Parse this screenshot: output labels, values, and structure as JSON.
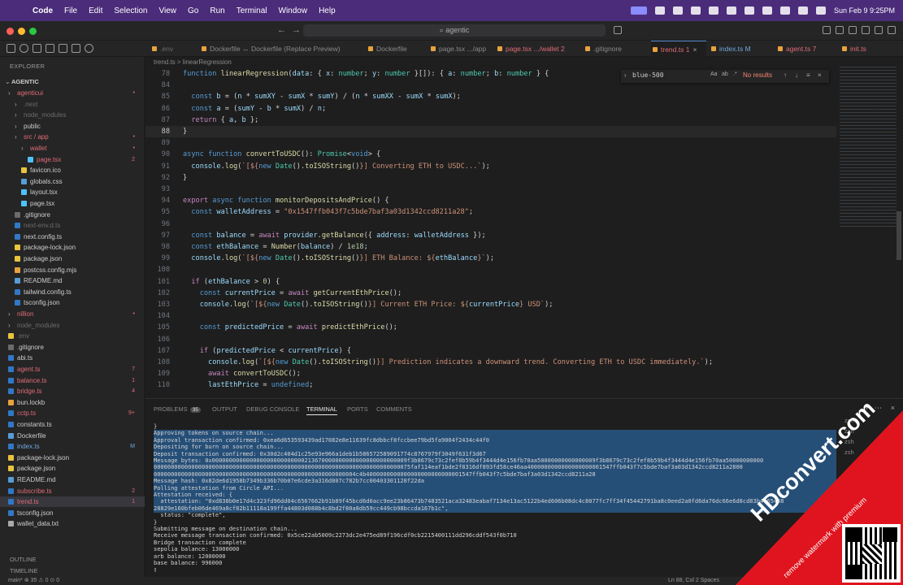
{
  "menubar": {
    "app": "Code",
    "items": [
      "File",
      "Edit",
      "Selection",
      "View",
      "Go",
      "Run",
      "Terminal",
      "Window",
      "Help"
    ],
    "clock": "Sun Feb 9  9:25PM"
  },
  "titlebar": {
    "search": "agentic"
  },
  "explorer": {
    "header": "EXPLORER",
    "root": "AGENTIC",
    "items": [
      {
        "label": "agenticui",
        "depth": 0,
        "color": "#e06c75",
        "badge": "•",
        "type": "folder"
      },
      {
        "label": ".next",
        "depth": 1,
        "color": "#6b6b6b",
        "type": "folder"
      },
      {
        "label": "node_modules",
        "depth": 1,
        "color": "#6b6b6b",
        "type": "folder"
      },
      {
        "label": "public",
        "depth": 1,
        "color": "#cccccc",
        "type": "folder"
      },
      {
        "label": "src / app",
        "depth": 1,
        "color": "#e06c75",
        "badge": "•",
        "type": "folder"
      },
      {
        "label": "wallet",
        "depth": 2,
        "color": "#e06c75",
        "badge": "•",
        "type": "folder"
      },
      {
        "label": "page.tsx",
        "depth": 3,
        "color": "#e06c75",
        "badge": "2",
        "type": "file",
        "icon": "#4fc1ff"
      },
      {
        "label": "favicon.ico",
        "depth": 2,
        "color": "#cccccc",
        "type": "file",
        "icon": "#e8c33d"
      },
      {
        "label": "globals.css",
        "depth": 2,
        "color": "#cccccc",
        "type": "file",
        "icon": "#569cd6"
      },
      {
        "label": "layout.tsx",
        "depth": 2,
        "color": "#cccccc",
        "type": "file",
        "icon": "#4fc1ff"
      },
      {
        "label": "page.tsx",
        "depth": 2,
        "color": "#cccccc",
        "type": "file",
        "icon": "#4fc1ff"
      },
      {
        "label": ".gitignore",
        "depth": 1,
        "color": "#cccccc",
        "type": "file",
        "icon": "#6b6b6b"
      },
      {
        "label": "next-env.d.ts",
        "depth": 1,
        "color": "#6b6b6b",
        "type": "file",
        "icon": "#3178c6"
      },
      {
        "label": "next.config.ts",
        "depth": 1,
        "color": "#cccccc",
        "type": "file",
        "icon": "#3178c6"
      },
      {
        "label": "package-lock.json",
        "depth": 1,
        "color": "#cccccc",
        "type": "file",
        "icon": "#e8c33d"
      },
      {
        "label": "package.json",
        "depth": 1,
        "color": "#cccccc",
        "type": "file",
        "icon": "#e8c33d"
      },
      {
        "label": "postcss.config.mjs",
        "depth": 1,
        "color": "#cccccc",
        "type": "file",
        "icon": "#e8a33d"
      },
      {
        "label": "README.md",
        "depth": 1,
        "color": "#cccccc",
        "type": "file",
        "icon": "#569cd6"
      },
      {
        "label": "tailwind.config.ts",
        "depth": 1,
        "color": "#cccccc",
        "type": "file",
        "icon": "#3178c6"
      },
      {
        "label": "tsconfig.json",
        "depth": 1,
        "color": "#cccccc",
        "type": "file",
        "icon": "#3178c6"
      },
      {
        "label": "nillion",
        "depth": 0,
        "color": "#e06c75",
        "badge": "•",
        "type": "folder"
      },
      {
        "label": "node_modules",
        "depth": 0,
        "color": "#6b6b6b",
        "type": "folder"
      },
      {
        "label": ".env",
        "depth": 0,
        "color": "#6b6b6b",
        "type": "file",
        "icon": "#e8c33d"
      },
      {
        "label": ".gitignore",
        "depth": 0,
        "color": "#cccccc",
        "type": "file",
        "icon": "#6b6b6b"
      },
      {
        "label": "abi.ts",
        "depth": 0,
        "color": "#cccccc",
        "type": "file",
        "icon": "#3178c6"
      },
      {
        "label": "agent.ts",
        "depth": 0,
        "color": "#e06c75",
        "badge": "7",
        "type": "file",
        "icon": "#3178c6"
      },
      {
        "label": "balance.ts",
        "depth": 0,
        "color": "#e06c75",
        "badge": "1",
        "type": "file",
        "icon": "#3178c6"
      },
      {
        "label": "bridge.ts",
        "depth": 0,
        "color": "#e06c75",
        "badge": "4",
        "type": "file",
        "icon": "#3178c6"
      },
      {
        "label": "bun.lockb",
        "depth": 0,
        "color": "#cccccc",
        "type": "file",
        "icon": "#e8a33d"
      },
      {
        "label": "cctp.ts",
        "depth": 0,
        "color": "#e06c75",
        "badge": "9+",
        "type": "file",
        "icon": "#3178c6"
      },
      {
        "label": "constants.ts",
        "depth": 0,
        "color": "#cccccc",
        "type": "file",
        "icon": "#3178c6"
      },
      {
        "label": "Dockerfile",
        "depth": 0,
        "color": "#cccccc",
        "type": "file",
        "icon": "#569cd6"
      },
      {
        "label": "index.ts",
        "depth": 0,
        "color": "#6fa8dc",
        "badge": "M",
        "type": "file",
        "icon": "#3178c6"
      },
      {
        "label": "package-lock.json",
        "depth": 0,
        "color": "#cccccc",
        "type": "file",
        "icon": "#e8c33d"
      },
      {
        "label": "package.json",
        "depth": 0,
        "color": "#cccccc",
        "type": "file",
        "icon": "#e8c33d"
      },
      {
        "label": "README.md",
        "depth": 0,
        "color": "#cccccc",
        "type": "file",
        "icon": "#569cd6"
      },
      {
        "label": "subscribe.ts",
        "depth": 0,
        "color": "#e06c75",
        "badge": "2",
        "type": "file",
        "icon": "#3178c6"
      },
      {
        "label": "trend.ts",
        "depth": 0,
        "color": "#e06c75",
        "badge": "1",
        "type": "file",
        "icon": "#3178c6",
        "selected": true
      },
      {
        "label": "tsconfig.json",
        "depth": 0,
        "color": "#cccccc",
        "type": "file",
        "icon": "#3178c6"
      },
      {
        "label": "wallet_data.txt",
        "depth": 0,
        "color": "#cccccc",
        "type": "file",
        "icon": "#aaaaaa"
      }
    ],
    "outline": "OUTLINE",
    "timeline": "TIMELINE"
  },
  "tabs": [
    {
      "label": ".env",
      "x": 0,
      "color": "#6b6b6b"
    },
    {
      "label": "Dockerfile ↔ Dockerfile (Replace Preview)",
      "color": "#8a8a8a"
    },
    {
      "label": "Dockerfile",
      "color": "#8a8a8a"
    },
    {
      "label": "page.tsx  .../app",
      "color": "#8a8a8a"
    },
    {
      "label": "page.tsx  .../wallet  2",
      "color": "#e06c75"
    },
    {
      "label": ".gitignore",
      "color": "#8a8a8a"
    },
    {
      "label": "trend.ts  1",
      "color": "#e06c75",
      "active": true
    },
    {
      "label": "index.ts  M",
      "color": "#6fa8dc"
    },
    {
      "label": "agent.ts  7",
      "color": "#e06c75"
    },
    {
      "label": "init.ts",
      "color": "#e06c75"
    }
  ],
  "breadcrumb": "trend.ts  >  linearRegression",
  "find": {
    "query": "blue-500",
    "result": "No results"
  },
  "code": [
    {
      "ln": "78",
      "html": "<span class='kb'>function</span> <span class='f'>linearRegression</span><span class='p'>(</span><span class='v'>data</span><span class='p'>: { </span><span class='v'>x</span><span class='p'>: </span><span class='t'>number</span><span class='p'>; </span><span class='v'>y</span><span class='p'>: </span><span class='t'>number</span><span class='p'> }[]): { </span><span class='v'>a</span><span class='p'>: </span><span class='t'>number</span><span class='p'>; </span><span class='v'>b</span><span class='p'>: </span><span class='t'>number</span><span class='p'> } {</span>"
    },
    {
      "ln": "84",
      "html": ""
    },
    {
      "ln": "85",
      "html": "  <span class='kb'>const</span> <span class='v'>b</span> <span class='p'>= (</span><span class='v'>n</span> <span class='p'>*</span> <span class='v'>sumXY</span> <span class='p'>-</span> <span class='v'>sumX</span> <span class='p'>*</span> <span class='v'>sumY</span><span class='p'>) / (</span><span class='v'>n</span> <span class='p'>*</span> <span class='v'>sumXX</span> <span class='p'>-</span> <span class='v'>sumX</span> <span class='p'>*</span> <span class='v'>sumX</span><span class='p'>);</span>"
    },
    {
      "ln": "86",
      "html": "  <span class='kb'>const</span> <span class='v'>a</span> <span class='p'>= (</span><span class='v'>sumY</span> <span class='p'>-</span> <span class='v'>b</span> <span class='p'>*</span> <span class='v'>sumX</span><span class='p'>) /</span> <span class='v'>n</span><span class='p'>;</span>"
    },
    {
      "ln": "87",
      "html": "  <span class='k'>return</span> <span class='p'>{ </span><span class='v'>a</span><span class='p'>, </span><span class='v'>b</span><span class='p'> };</span>"
    },
    {
      "ln": "88",
      "html": "<span class='p'>}</span>",
      "cur": true
    },
    {
      "ln": "89",
      "html": ""
    },
    {
      "ln": "90",
      "html": "<span class='kb'>async</span> <span class='kb'>function</span> <span class='f'>convertToUSDC</span><span class='p'>(): </span><span class='t'>Promise</span><span class='p'>&lt;</span><span class='kb'>void</span><span class='p'>&gt; {</span>"
    },
    {
      "ln": "91",
      "html": "  <span class='v'>console</span><span class='p'>.</span><span class='f'>log</span><span class='p'>(</span><span class='tpl'>`[${</span><span class='kb'>new</span> <span class='t'>Date</span><span class='p'>().</span><span class='f'>toISOString</span><span class='p'>()</span><span class='tpl'>}] Converting ETH to USDC...`</span><span class='p'>);</span>"
    },
    {
      "ln": "92",
      "html": "<span class='p'>}</span>"
    },
    {
      "ln": "93",
      "html": ""
    },
    {
      "ln": "94",
      "html": "<span class='k'>export</span> <span class='kb'>async</span> <span class='kb'>function</span> <span class='f'>monitorDepositsAndPrice</span><span class='p'>() {</span>"
    },
    {
      "ln": "95",
      "html": "  <span class='kb'>const</span> <span class='v'>walletAddress</span> <span class='p'>=</span> <span class='s'>\"0x1547ffb043f7c5bde7baf3a03d1342ccd8211a28\"</span><span class='p'>;</span>"
    },
    {
      "ln": "96",
      "html": ""
    },
    {
      "ln": "97",
      "html": "  <span class='kb'>const</span> <span class='v'>balance</span> <span class='p'>=</span> <span class='k'>await</span> <span class='v'>provider</span><span class='p'>.</span><span class='f'>getBalance</span><span class='p'>({ </span><span class='v'>address</span><span class='p'>: </span><span class='v'>walletAddress</span><span class='p'> });</span>"
    },
    {
      "ln": "98",
      "html": "  <span class='kb'>const</span> <span class='v'>ethBalance</span> <span class='p'>=</span> <span class='f'>Number</span><span class='p'>(</span><span class='v'>balance</span><span class='p'>) /</span> <span class='n'>1e18</span><span class='p'>;</span>"
    },
    {
      "ln": "99",
      "html": "  <span class='v'>console</span><span class='p'>.</span><span class='f'>log</span><span class='p'>(</span><span class='tpl'>`[${</span><span class='kb'>new</span> <span class='t'>Date</span><span class='p'>().</span><span class='f'>toISOString</span><span class='p'>()</span><span class='tpl'>}] ETH Balance: ${</span><span class='v'>ethBalance</span><span class='tpl'>}`</span><span class='p'>);</span>"
    },
    {
      "ln": "100",
      "html": ""
    },
    {
      "ln": "101",
      "html": "  <span class='k'>if</span> <span class='p'>(</span><span class='v'>ethBalance</span> <span class='p'>&gt;</span> <span class='n'>0</span><span class='p'>) {</span>"
    },
    {
      "ln": "102",
      "html": "    <span class='kb'>const</span> <span class='v'>currentPrice</span> <span class='p'>=</span> <span class='k'>await</span> <span class='f'>getCurrentEthPrice</span><span class='p'>();</span>"
    },
    {
      "ln": "103",
      "html": "    <span class='v'>console</span><span class='p'>.</span><span class='f'>log</span><span class='p'>(</span><span class='tpl'>`[${</span><span class='kb'>new</span> <span class='t'>Date</span><span class='p'>().</span><span class='f'>toISOString</span><span class='p'>()</span><span class='tpl'>}] Current ETH Price: ${</span><span class='v'>currentPrice</span><span class='tpl'>} USD`</span><span class='p'>);</span>"
    },
    {
      "ln": "104",
      "html": ""
    },
    {
      "ln": "105",
      "html": "    <span class='kb'>const</span> <span class='v'>predictedPrice</span> <span class='p'>=</span> <span class='k'>await</span> <span class='f'>predictEthPrice</span><span class='p'>();</span>"
    },
    {
      "ln": "106",
      "html": ""
    },
    {
      "ln": "107",
      "html": "    <span class='k'>if</span> <span class='p'>(</span><span class='v'>predictedPrice</span> <span class='p'>&lt;</span> <span class='v'>currentPrice</span><span class='p'>) {</span>"
    },
    {
      "ln": "108",
      "html": "      <span class='v'>console</span><span class='p'>.</span><span class='f'>log</span><span class='p'>(</span><span class='tpl'>`[${</span><span class='kb'>new</span> <span class='t'>Date</span><span class='p'>().</span><span class='f'>toISOString</span><span class='p'>()</span><span class='tpl'>}] Prediction indicates a downward trend. Converting ETH to USDC immediately.`</span><span class='p'>);</span>"
    },
    {
      "ln": "109",
      "html": "      <span class='k'>await</span> <span class='f'>convertToUSDC</span><span class='p'>();</span>"
    },
    {
      "ln": "110",
      "html": "      <span class='v'>lastEthPrice</span> <span class='p'>=</span> <span class='kb'>undefined</span><span class='p'>;</span>"
    }
  ],
  "panel": {
    "tabs": [
      {
        "label": "PROBLEMS",
        "count": "35"
      },
      {
        "label": "OUTPUT"
      },
      {
        "label": "DEBUG CONSOLE"
      },
      {
        "label": "TERMINAL",
        "active": true
      },
      {
        "label": "PORTS"
      },
      {
        "label": "COMMENTS"
      }
    ],
    "terminals": [
      "zsh",
      "zsh",
      "zsh",
      "zsh"
    ],
    "lines": [
      {
        "t": "}"
      },
      {
        "t": "Approving tokens on source chain...",
        "hl": true
      },
      {
        "t": "Approval transaction confirmed: 0xea6d653593439ad17082e8e11639fc8dbbcf8fccbee79bd5fa9004f2434c44f0",
        "hl": true
      },
      {
        "t": "Depositing for burn on source chain...",
        "hl": true
      },
      {
        "t": "Deposit transaction confirmed: 0x30d2c404d1c25e93e966a1deb1b586572589091774c8767979f3049f631f3d67",
        "hl": true
      },
      {
        "t": "Message bytes: 0x000000000000000000000000000213670000000000000000000000009f3b8679c73c2fef8b59b4f3444d4e156fb70aa50000000000000009f3b8679c73c2fef8b59b4f3444d4e156fb70aa50000000000",
        "hl": true
      },
      {
        "t": "000000000000000000000000000000000000000000000000000000000000000000000000075faf114eaf1bde2f8316df893fd58ce46aa4000000000000000000001547ffb043f7c5bde7baf3a03d1342ccd8211a2800",
        "hl": true
      },
      {
        "t": "00000000000000000000000000000000000000000000000000000000004c4b4000000000000000000000000001547ffb043f7c5bde7baf3a03d1342ccd8211a28",
        "hl": true
      },
      {
        "t": "Message hash: 0x82de6d1958b7349b336b70b07e6cde3a316d807c782b7cc00403301128f22da",
        "hl": true
      },
      {
        "t": "Polling attestation from Circle API...",
        "hl": true
      },
      {
        "t": "Attestation received: {",
        "hl": true
      },
      {
        "t": "  attestation: \"0xd838b0e17d4c323fd96dd04c6567662b91b89f45bcd6d0acc9ee23b86473b7483521aca32483eabaf7134e13ac5122b4ed606b08dc4c8077fc7ff34f45442791ba8c0eed2a0fd6da76dc66e6d8cd83b4c65488",
        "hl": true
      },
      {
        "t": "28829e160bfeb06de469a8cf82b11118a199ffa44803d088b4c8bd2f80a8db59cc449cb98bccda167b1c\",",
        "hl": true
      },
      {
        "t": "  status: \"complete\","
      },
      {
        "t": "}"
      },
      {
        "t": "Submitting message on destination chain..."
      },
      {
        "t": "Receive message transaction confirmed: 0x5ce22ab5009c2273dc2e475ed89f196cdf0cb2215400111dd296cddf543f0b710"
      },
      {
        "t": "Bridge transaction complete"
      },
      {
        "t": "sepolia balance: 13000000"
      },
      {
        "t": "arb balance: 12000000"
      },
      {
        "t": "base balance: 996000"
      },
      {
        "t": "▯"
      }
    ]
  },
  "status": {
    "left": "main*   ⊗ 35  ⚠ 0   ⊙ 0",
    "right": "Ln 88, Col 2    Spaces"
  },
  "watermark": {
    "brand": "HDconvert.com",
    "tagline": "remove watermark with premium"
  }
}
